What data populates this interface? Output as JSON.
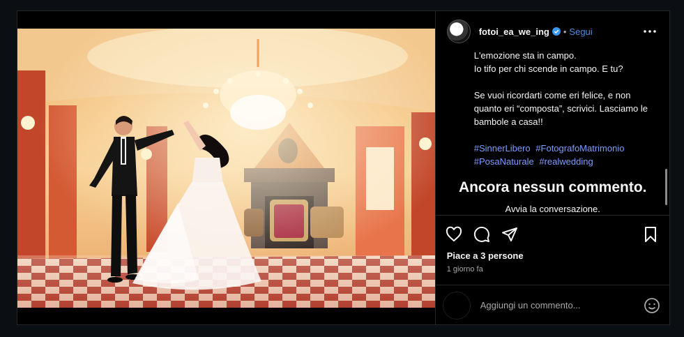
{
  "post": {
    "username": "fotoi_ea_we_ing",
    "separator": "•",
    "follow_label": "Segui",
    "caption": {
      "line1": "L'emozione sta in campo.",
      "line2": "Io tifo per chi scende in campo. E tu?",
      "paragraph2": "Se vuoi ricordarti come eri felice, e non quanto eri “composta”, scrivici. Lasciamo le bambole a casa!!",
      "hashtags": [
        "#SinnerLibero",
        "#FotografoMatrimonio",
        "#PosaNaturale",
        "#realwedding"
      ]
    },
    "comments_empty_title": "Ancora nessun commento.",
    "comments_empty_subtitle": "Avvia la conversazione.",
    "likes_text": "Piace a 3 persone",
    "time_text": "1 giorno fa",
    "comment_placeholder": "Aggiungi un commento..."
  },
  "icons": {
    "verified": "verified-badge-icon",
    "more": "more-options-icon",
    "like": "heart-icon",
    "comment": "comment-icon",
    "share": "share-icon",
    "save": "bookmark-icon",
    "emoji": "emoji-icon"
  },
  "colors": {
    "link_blue": "#4a90e2",
    "hashtag": "#7e9cff",
    "background": "#000000"
  }
}
